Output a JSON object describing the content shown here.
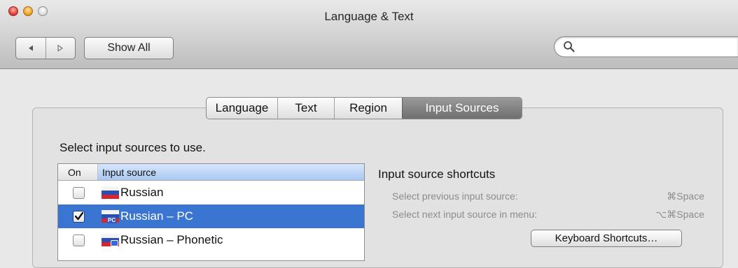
{
  "window": {
    "title": "Language & Text"
  },
  "toolbar": {
    "back_icon": "triangle-left",
    "forward_icon": "triangle-right",
    "show_all_label": "Show All",
    "search_value": "",
    "search_icon": "magnifier"
  },
  "tabs": [
    {
      "label": "Language",
      "selected": false
    },
    {
      "label": "Text",
      "selected": false
    },
    {
      "label": "Region",
      "selected": false
    },
    {
      "label": "Input Sources",
      "selected": true
    }
  ],
  "instruction": "Select input sources to use.",
  "list": {
    "columns": [
      "On",
      "Input source"
    ],
    "rows": [
      {
        "checked": false,
        "label": "Russian",
        "selected": false
      },
      {
        "checked": true,
        "label": "Russian – PC",
        "selected": true
      },
      {
        "checked": false,
        "label": "Russian – Phonetic",
        "selected": false
      }
    ]
  },
  "shortcuts": {
    "title": "Input source shortcuts",
    "items": [
      {
        "label": "Select previous input source:",
        "key": "⌘Space"
      },
      {
        "label": "Select next input source in menu:",
        "key": "⌥⌘Space"
      }
    ],
    "keyboard_button": "Keyboard Shortcuts…"
  },
  "colors": {
    "selection": "#3a75d2",
    "selected_tab": "#7f7f7f"
  }
}
